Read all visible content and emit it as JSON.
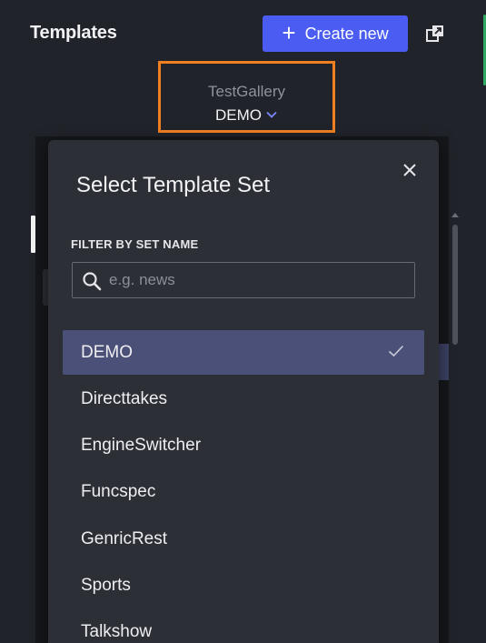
{
  "header": {
    "title": "Templates",
    "create_button_label": "Create new"
  },
  "gallery": {
    "name": "TestGallery",
    "selected_set": "DEMO"
  },
  "modal": {
    "title": "Select Template Set",
    "filter_label": "FILTER BY SET NAME",
    "search_placeholder": "e.g. news",
    "search_value": "",
    "sets": [
      {
        "label": "DEMO",
        "selected": true
      },
      {
        "label": "Directtakes",
        "selected": false
      },
      {
        "label": "EngineSwitcher",
        "selected": false
      },
      {
        "label": "Funcspec",
        "selected": false
      },
      {
        "label": "GenricRest",
        "selected": false
      },
      {
        "label": "Sports",
        "selected": false
      },
      {
        "label": "Talkshow",
        "selected": false
      }
    ]
  },
  "colors": {
    "accent": "#4b5cf2",
    "highlight_border": "#f07f22",
    "selected_row": "#4a5078",
    "background": "#202329",
    "modal_background": "#2c2f36"
  },
  "icons": {
    "create": "plus-icon",
    "popout": "popout-icon",
    "dropdown": "chevron-down-icon",
    "close": "close-icon",
    "search": "search-icon",
    "selected": "check-icon"
  }
}
